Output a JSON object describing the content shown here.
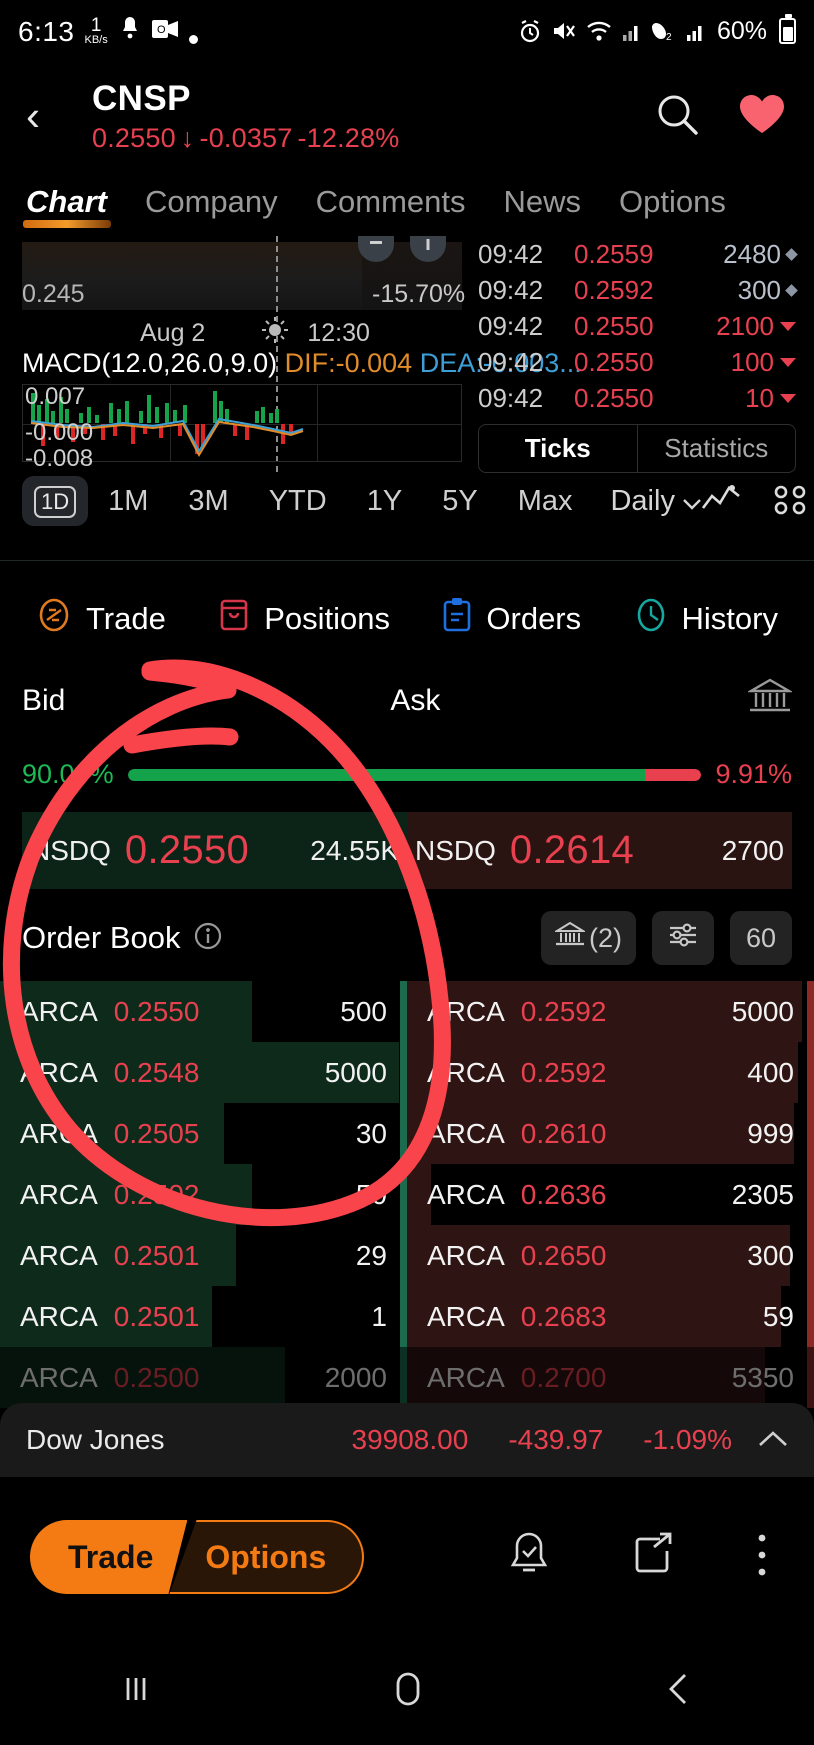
{
  "status_bar": {
    "time": "6:13",
    "net_rate_value": "1",
    "net_rate_unit": "KB/s",
    "battery_percent": "60%",
    "icons": [
      "bell-icon",
      "outlook-icon",
      "dot-icon",
      "alarm-icon",
      "mute-icon",
      "wifi-icon",
      "signal-icon",
      "call-icon",
      "signal2-icon",
      "battery-icon"
    ]
  },
  "header": {
    "back": "‹",
    "symbol": "CNSP",
    "price": "0.2550",
    "arrow": "↓",
    "change": "-0.0357",
    "change_pct": "-12.28%",
    "search_icon": "search-icon",
    "favorite_icon": "heart-icon"
  },
  "tabs": [
    {
      "label": "Chart",
      "active": true
    },
    {
      "label": "Company",
      "active": false
    },
    {
      "label": "Comments",
      "active": false
    },
    {
      "label": "News",
      "active": false
    },
    {
      "label": "Options",
      "active": false
    }
  ],
  "chart": {
    "price_axis_label": "0.245",
    "date_label": "Aug 2",
    "time_label": "12:30",
    "pct_label": "-15.70%",
    "macd_title": "MACD(12.0,26.0,9.0)",
    "macd_dif": "DIF:-0.004",
    "macd_dea": "DEA:-0.003...",
    "macd_high": "0.007",
    "macd_mid": "-0.000",
    "macd_low": "-0.008"
  },
  "ticks": {
    "rows": [
      {
        "time": "09:42",
        "price": "0.2559",
        "size": "2480",
        "dir": "neutral"
      },
      {
        "time": "09:42",
        "price": "0.2592",
        "size": "300",
        "dir": "neutral"
      },
      {
        "time": "09:42",
        "price": "0.2550",
        "size": "2100",
        "dir": "down"
      },
      {
        "time": "09:42",
        "price": "0.2550",
        "size": "100",
        "dir": "down"
      },
      {
        "time": "09:42",
        "price": "0.2550",
        "size": "10",
        "dir": "down"
      }
    ],
    "toggle": [
      {
        "label": "Ticks",
        "active": true
      },
      {
        "label": "Statistics",
        "active": false
      }
    ]
  },
  "timeframes": [
    {
      "label": "1D",
      "active": true
    },
    {
      "label": "1M",
      "active": false
    },
    {
      "label": "3M",
      "active": false
    },
    {
      "label": "YTD",
      "active": false
    },
    {
      "label": "1Y",
      "active": false
    },
    {
      "label": "5Y",
      "active": false
    },
    {
      "label": "Max",
      "active": false
    }
  ],
  "interval_select": "Daily",
  "chart_icons": [
    "line-chart-icon",
    "grid-layout-icon"
  ],
  "action_row": [
    {
      "label": "Trade",
      "icon": "trade-icon",
      "color": "#e07a1f"
    },
    {
      "label": "Positions",
      "icon": "positions-icon",
      "color": "#d6364a"
    },
    {
      "label": "Orders",
      "icon": "orders-icon",
      "color": "#1f6fe0"
    },
    {
      "label": "History",
      "icon": "history-clock-icon",
      "color": "#16a8a0"
    }
  ],
  "quote_panel": {
    "bid_label": "Bid",
    "ask_label": "Ask",
    "exchange_icon": "bank-icon",
    "bid_ratio": "90.09%",
    "ask_ratio": "9.91%",
    "bid_ratio_value": 90.09,
    "ask_ratio_value": 9.91,
    "best_bid": {
      "venue": "NSDQ",
      "price": "0.2550",
      "size": "24.55K"
    },
    "best_ask": {
      "venue": "NSDQ",
      "price": "0.2614",
      "size": "2700"
    }
  },
  "order_book": {
    "title": "Order Book",
    "info_icon": "info-icon",
    "buttons": [
      {
        "label": "(2)",
        "icon": "bank-icon",
        "name": "exchange-filter-button"
      },
      {
        "label": "",
        "icon": "sliders-icon",
        "name": "settings-button"
      },
      {
        "label": "60",
        "icon": "",
        "name": "depth-count-button"
      }
    ],
    "rows": [
      {
        "bid": {
          "venue": "ARCA",
          "price": "0.2550",
          "size": "500",
          "depth": 62
        },
        "ask": {
          "venue": "ARCA",
          "price": "0.2592",
          "size": "5000",
          "depth": 97
        }
      },
      {
        "bid": {
          "venue": "ARCA",
          "price": "0.2548",
          "size": "5000",
          "depth": 98
        },
        "ask": {
          "venue": "ARCA",
          "price": "0.2592",
          "size": "400",
          "depth": 96
        }
      },
      {
        "bid": {
          "venue": "ARCA",
          "price": "0.2505",
          "size": "30",
          "depth": 55
        },
        "ask": {
          "venue": "ARCA",
          "price": "0.2610",
          "size": "999",
          "depth": 95
        }
      },
      {
        "bid": {
          "venue": "ARCA",
          "price": "0.2502",
          "size": "50",
          "depth": 62
        },
        "ask": {
          "venue": "ARCA",
          "price": "0.2636",
          "size": "2305",
          "depth": 6
        }
      },
      {
        "bid": {
          "venue": "ARCA",
          "price": "0.2501",
          "size": "29",
          "depth": 58
        },
        "ask": {
          "venue": "ARCA",
          "price": "0.2650",
          "size": "300",
          "depth": 94
        }
      },
      {
        "bid": {
          "venue": "ARCA",
          "price": "0.2501",
          "size": "1",
          "depth": 52
        },
        "ask": {
          "venue": "ARCA",
          "price": "0.2683",
          "size": "59",
          "depth": 92
        }
      },
      {
        "bid": {
          "venue": "ARCA",
          "price": "0.2500",
          "size": "2000",
          "depth": 70
        },
        "ask": {
          "venue": "ARCA",
          "price": "0.2700",
          "size": "5350",
          "depth": 88
        }
      }
    ]
  },
  "index_ticker": {
    "name": "Dow Jones",
    "value": "39908.00",
    "change": "-439.97",
    "change_pct": "-1.09%",
    "chevron": "chevron-up-icon"
  },
  "bottom_bar": {
    "trade_label": "Trade",
    "options_label": "Options",
    "icons": [
      "alert-bell-icon",
      "share-icon",
      "more-vertical-icon"
    ]
  },
  "nav_bar": {
    "recents": "recents-icon",
    "home": "home-icon",
    "back": "back-icon"
  },
  "annotation": {
    "present": true,
    "shape": "hand-drawn-circle",
    "color": "#f9444b"
  }
}
